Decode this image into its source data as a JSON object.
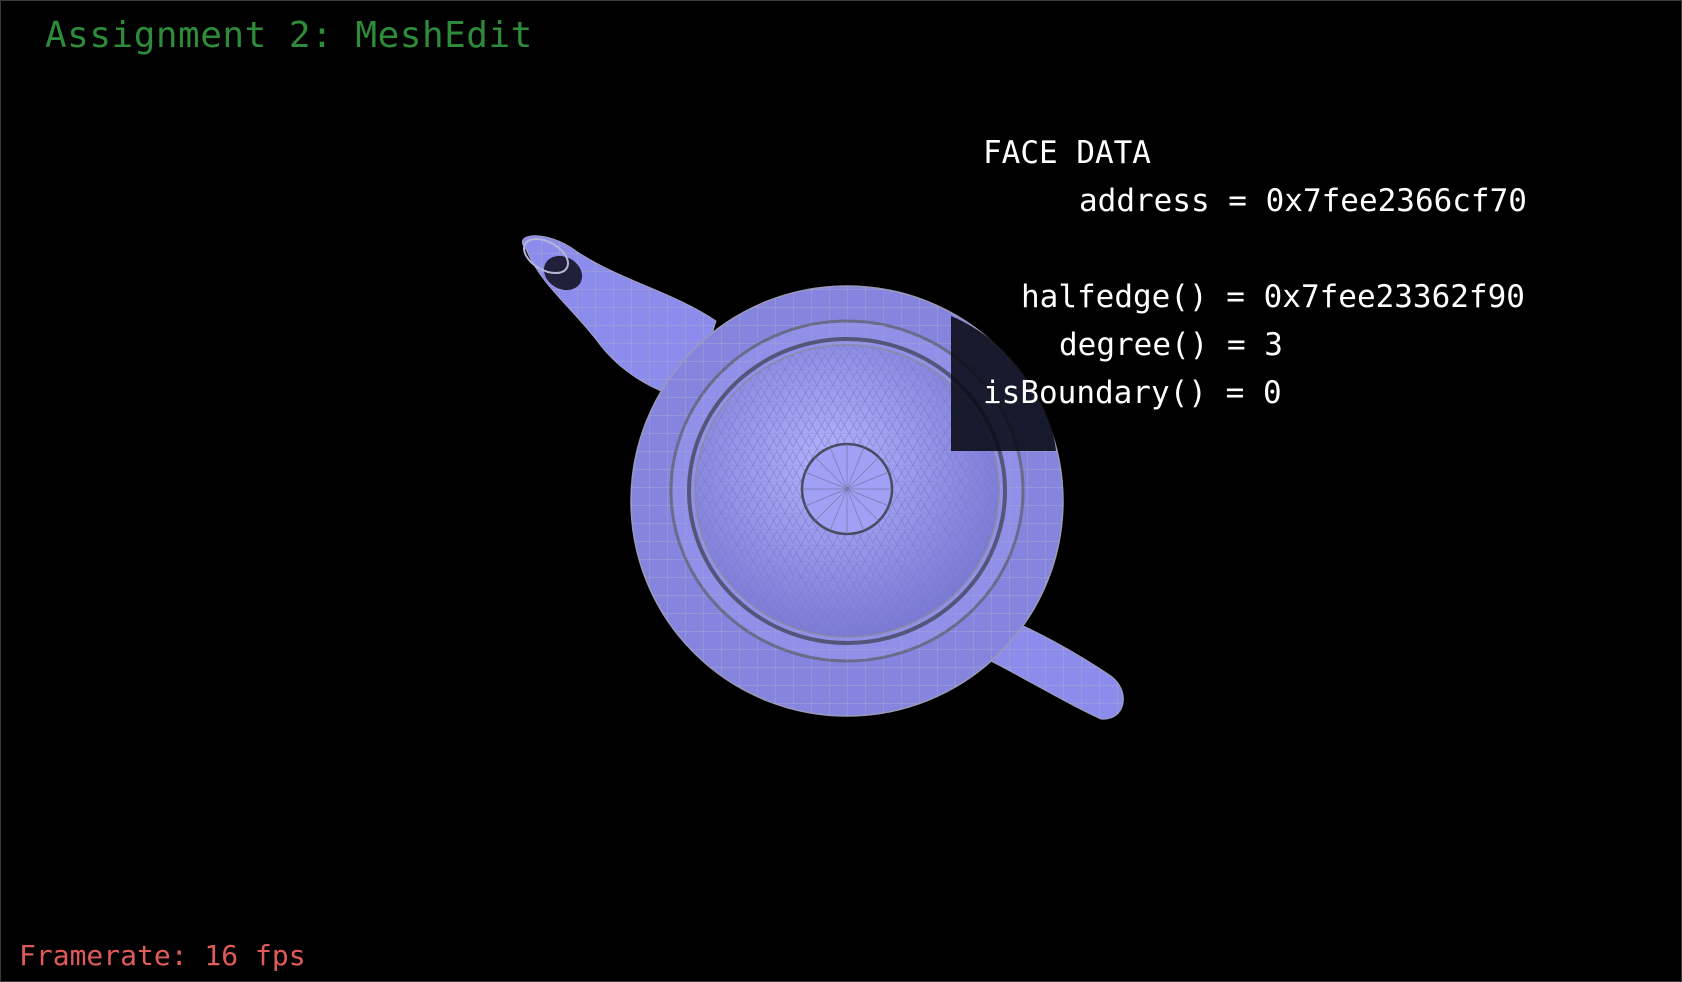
{
  "app": {
    "title": "Assignment 2: MeshEdit",
    "framerate": "Framerate: 16 fps"
  },
  "colors": {
    "background": "#000000",
    "title": "#2e8b3a",
    "framerate": "#e05a5a",
    "mesh_fill": "#9b9bf5",
    "mesh_wire": "#a8a8b8",
    "info_text": "#ffffff"
  },
  "face_data": {
    "heading": "FACE DATA",
    "address": "address = 0x7fee2366cf70",
    "halfedge": "halfedge() = 0x7fee23362f90",
    "degree": "degree() = 3",
    "is_boundary": "isBoundary() = 0"
  }
}
